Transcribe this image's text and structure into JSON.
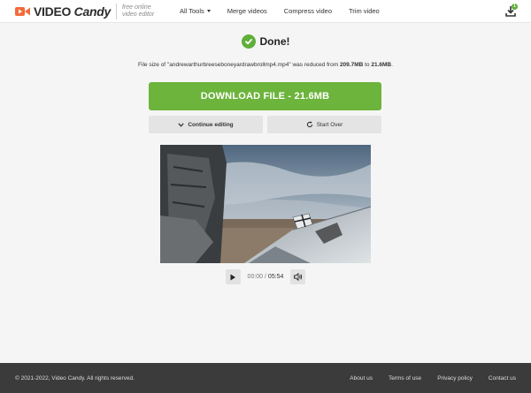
{
  "header": {
    "logo_text_a": "VIDEO",
    "logo_text_b": "Candy",
    "tagline": "free online video editor",
    "nav": [
      {
        "label": "All Tools"
      },
      {
        "label": "Merge videos"
      },
      {
        "label": "Compress video"
      },
      {
        "label": "Trim video"
      }
    ],
    "download_badge": "1"
  },
  "main": {
    "done_title": "Done!",
    "size_msg_prefix": "File size of \"andrewarthurbreeseboneyardrawbrollmp4.mp4\" was reduced from ",
    "size_from": "209.7MB",
    "size_mid": " to ",
    "size_to": "21.6MB",
    "size_suffix": ".",
    "download_label": "DOWNLOAD FILE - 21.6MB",
    "continue_label": "Continue editing",
    "start_over_label": "Start Over"
  },
  "player": {
    "current_time": "00:00",
    "separator": " / ",
    "total_time": "05:54"
  },
  "footer": {
    "copyright": "© 2021-2022, Video Candy. All rights reserved.",
    "links": [
      {
        "label": "About us"
      },
      {
        "label": "Terms of use"
      },
      {
        "label": "Privacy policy"
      },
      {
        "label": "Contact us"
      }
    ]
  },
  "colors": {
    "accent_green": "#6cb43c",
    "logo_orange": "#f26b3a",
    "footer_bg": "#3b3b3b"
  },
  "icons": {
    "logo": "video-camera-icon",
    "download": "download-tray-icon",
    "done": "check-circle-icon",
    "continue": "chevron-down-icon",
    "start_over": "refresh-icon",
    "play": "play-icon",
    "volume": "volume-icon"
  }
}
